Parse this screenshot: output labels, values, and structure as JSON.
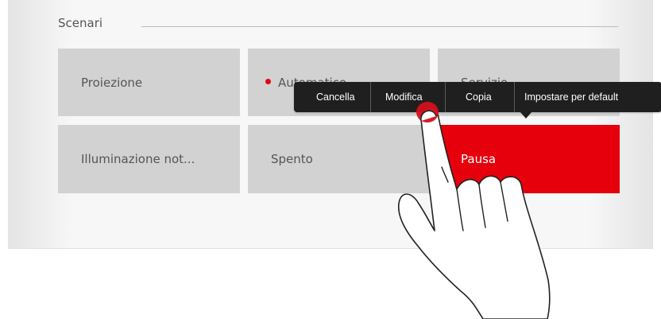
{
  "section": {
    "title": "Scenari"
  },
  "tiles": [
    {
      "label": "Proiezione"
    },
    {
      "label": "Automatico",
      "indicator_color": "#e30613"
    },
    {
      "label": "Servizio"
    },
    {
      "label": "Illuminazione not..."
    },
    {
      "label": "Spento"
    },
    {
      "label": "Pausa",
      "active": true
    }
  ],
  "context_menu": {
    "items": [
      "Cancella",
      "Modifica",
      "Copia",
      "Impostare per default"
    ]
  },
  "colors": {
    "accent": "#e5000c",
    "tile_bg": "#d2d2d2",
    "menu_bg": "#1f1f1f",
    "touch_marker": "#d4111b"
  },
  "overlay": {
    "icon": "pointing-hand-icon",
    "touch_marker": "touch-point-icon"
  }
}
